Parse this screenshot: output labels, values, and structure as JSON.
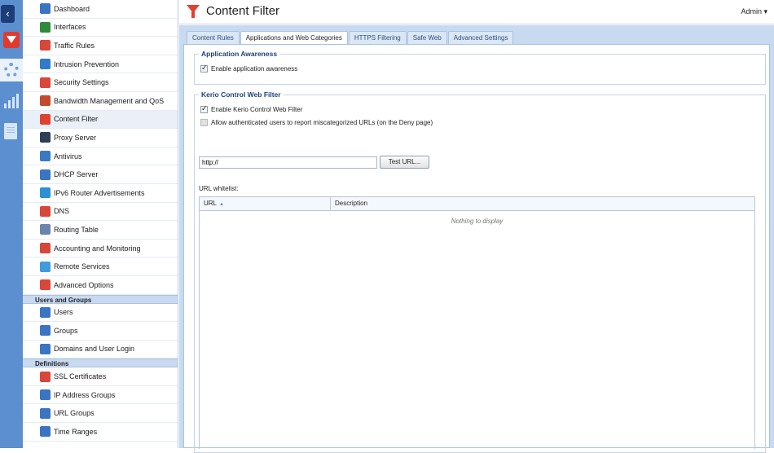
{
  "header": {
    "title": "Content Filter",
    "user": "Admin"
  },
  "sidebar": {
    "items": [
      {
        "label": "Dashboard",
        "icon": "dashboard-icon",
        "color": "#3a75c4"
      },
      {
        "label": "Interfaces",
        "icon": "interfaces-icon",
        "color": "#2f8a3b"
      },
      {
        "label": "Traffic Rules",
        "icon": "traffic-rules-icon",
        "color": "#d9463a"
      },
      {
        "label": "Intrusion Prevention",
        "icon": "shield-icon",
        "color": "#2f7bd0"
      },
      {
        "label": "Security Settings",
        "icon": "security-settings-icon",
        "color": "#d9463a"
      },
      {
        "label": "Bandwidth Management and QoS",
        "icon": "bandwidth-icon",
        "color": "#c44a2e"
      },
      {
        "label": "Content Filter",
        "icon": "funnel-icon",
        "color": "#e2402f"
      },
      {
        "label": "Proxy Server",
        "icon": "proxy-icon",
        "color": "#2d3e57"
      },
      {
        "label": "Antivirus",
        "icon": "antivirus-icon",
        "color": "#3b78c6"
      },
      {
        "label": "DHCP Server",
        "icon": "dhcp-icon",
        "color": "#3a75c4"
      },
      {
        "label": "IPv6 Router Advertisements",
        "icon": "ipv6-icon",
        "color": "#2f8fd6"
      },
      {
        "label": "DNS",
        "icon": "dns-icon",
        "color": "#d9463a"
      },
      {
        "label": "Routing Table",
        "icon": "routing-table-icon",
        "color": "#6a84ad"
      },
      {
        "label": "Accounting and Monitoring",
        "icon": "accounting-icon",
        "color": "#d9463a"
      },
      {
        "label": "Remote Services",
        "icon": "remote-services-icon",
        "color": "#3f9be0"
      },
      {
        "label": "Advanced Options",
        "icon": "advanced-options-icon",
        "color": "#d9463a"
      }
    ],
    "groups": [
      {
        "heading": "Users and Groups",
        "items": [
          {
            "label": "Users",
            "icon": "user-icon",
            "color": "#3a75c4"
          },
          {
            "label": "Groups",
            "icon": "groups-icon",
            "color": "#3a75c4"
          },
          {
            "label": "Domains and User Login",
            "icon": "domains-icon",
            "color": "#3a75c4"
          }
        ]
      },
      {
        "heading": "Definitions",
        "items": [
          {
            "label": "SSL Certificates",
            "icon": "certificate-icon",
            "color": "#d9463a"
          },
          {
            "label": "IP Address Groups",
            "icon": "ip-address-groups-icon",
            "color": "#3a75c4"
          },
          {
            "label": "URL Groups",
            "icon": "url-groups-icon",
            "color": "#3a75c4"
          },
          {
            "label": "Time Ranges",
            "icon": "clock-icon",
            "color": "#3a75c4"
          }
        ]
      }
    ]
  },
  "tabs": [
    {
      "label": "Content Rules",
      "active": false
    },
    {
      "label": "Applications and Web Categories",
      "active": true
    },
    {
      "label": "HTTPS Filtering",
      "active": false
    },
    {
      "label": "Safe Web",
      "active": false
    },
    {
      "label": "Advanced Settings",
      "active": false
    }
  ],
  "app_awareness": {
    "legend": "Application Awareness",
    "enable_label": "Enable application awareness",
    "enabled": true
  },
  "web_filter": {
    "legend": "Kerio Control Web Filter",
    "enable_label": "Enable Kerio Control Web Filter",
    "enabled": true,
    "report_label": "Allow authenticated users to report miscategorized URLs (on the Deny page)",
    "report_enabled": false,
    "test_url_value": "http://",
    "test_button": "Test URL...",
    "whitelist_label": "URL whitelist:",
    "columns": {
      "url": "URL",
      "description": "Description"
    },
    "empty_text": "Nothing to display"
  }
}
